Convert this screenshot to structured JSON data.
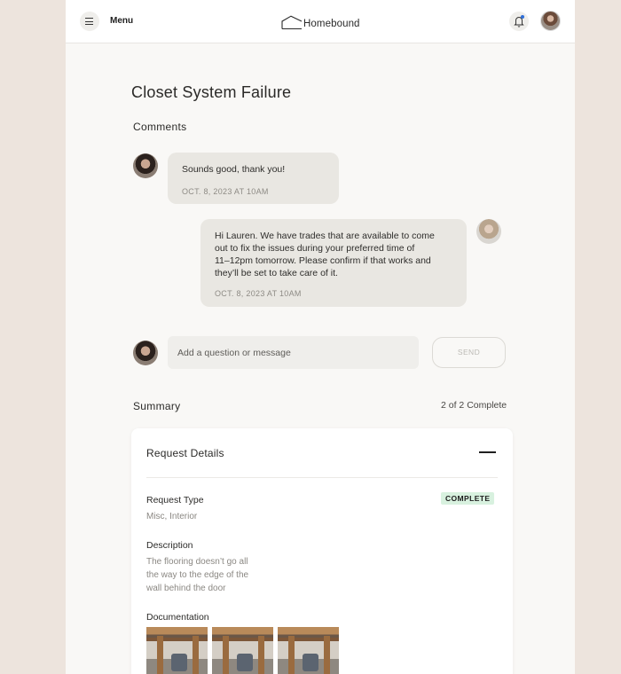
{
  "header": {
    "menu_label": "Menu",
    "logo_text": "Homebound",
    "menu_icon": "hamburger-icon",
    "logo_icon": "house-outline-icon",
    "notification_icon": "bell-icon"
  },
  "page_title": "Closet System Failure",
  "comments": {
    "heading": "Comments",
    "items": [
      {
        "text": "Sounds good, thank you!",
        "timestamp": "OCT. 8, 2023 AT 10AM"
      },
      {
        "lines": [
          "Hi Lauren. We have trades that are available to come",
          "out to fix the issues during your preferred time of",
          "11–12pm tomorrow. Please confirm if that works and",
          "they’ll be set to take care of it."
        ],
        "timestamp": "OCT. 8, 2023 AT 10AM"
      }
    ],
    "input_placeholder": "Add a question or message",
    "send_label": "SEND"
  },
  "summary": {
    "heading": "Summary",
    "progress": "2 of 2 Complete",
    "card": {
      "title": "Request Details",
      "status_badge": "COMPLETE",
      "status_color": "#d8f1df",
      "request_type_label": "Request Type",
      "request_type_value": "Misc, Interior",
      "description_label": "Description",
      "description_lines": [
        "The flooring doesn’t go all",
        "the way to the edge of the",
        "wall behind the door"
      ],
      "documentation_label": "Documentation"
    }
  }
}
